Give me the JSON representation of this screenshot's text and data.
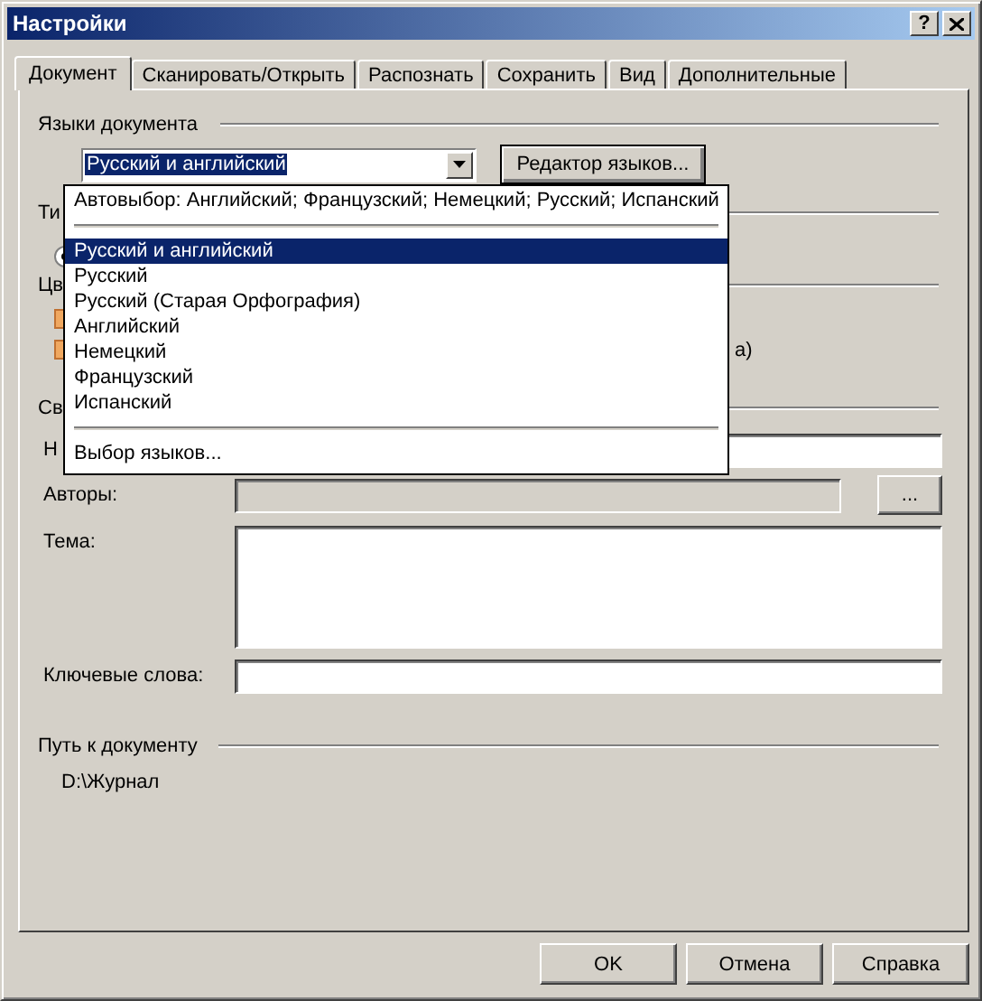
{
  "window": {
    "title": "Настройки",
    "help_button": "?"
  },
  "tabs": [
    {
      "label": "Документ",
      "selected": true
    },
    {
      "label": "Сканировать/Открыть",
      "selected": false
    },
    {
      "label": "Распознать",
      "selected": false
    },
    {
      "label": "Сохранить",
      "selected": false
    },
    {
      "label": "Вид",
      "selected": false
    },
    {
      "label": "Дополнительные",
      "selected": false
    }
  ],
  "languages": {
    "heading": "Языки документа",
    "combo_value": "Русский и английский",
    "editor_button": "Редактор языков...",
    "dropdown": [
      {
        "kind": "item",
        "label": "Автовыбор: Английский; Французский; Немецкий; Русский; Испанский",
        "selected": false
      },
      {
        "kind": "separator"
      },
      {
        "kind": "item",
        "label": "Русский и английский",
        "selected": true
      },
      {
        "kind": "item",
        "label": "Русский",
        "selected": false
      },
      {
        "kind": "item",
        "label": "Русский (Старая Орфография)",
        "selected": false
      },
      {
        "kind": "item",
        "label": "Английский",
        "selected": false
      },
      {
        "kind": "item",
        "label": "Немецкий",
        "selected": false
      },
      {
        "kind": "item",
        "label": "Французский",
        "selected": false
      },
      {
        "kind": "item",
        "label": "Испанский",
        "selected": false
      },
      {
        "kind": "separator"
      },
      {
        "kind": "item",
        "label": "Выбор языков...",
        "selected": false
      }
    ]
  },
  "covered": {
    "type_heading": "Ти",
    "color_heading": "Цв",
    "color_option_tail": "а)",
    "properties_heading": "Св"
  },
  "properties": [
    {
      "kind": "line",
      "label": "Н",
      "disabled": false
    },
    {
      "kind": "line",
      "label": "Авторы:",
      "disabled": true,
      "button": "..."
    },
    {
      "kind": "multiline",
      "label": "Тема:",
      "disabled": false
    },
    {
      "kind": "line",
      "label": "Ключевые слова:",
      "disabled": false
    }
  ],
  "path": {
    "heading": "Путь к документу",
    "value": "D:\\Журнал"
  },
  "buttons": [
    "OK",
    "Отмена",
    "Справка"
  ]
}
